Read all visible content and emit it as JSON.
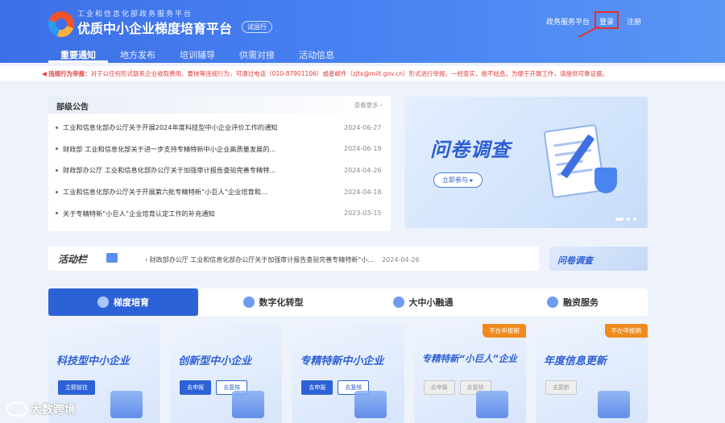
{
  "header": {
    "sub_title": "工业和信息化部政务服务平台",
    "title": "优质中小企业梯度培育平台",
    "badge": "试运行",
    "links": {
      "gov_portal": "政务服务平台",
      "login": "登录",
      "register": "注册"
    }
  },
  "nav": [
    "重要通知",
    "地方发布",
    "培训辅导",
    "供需对接",
    "活动信息"
  ],
  "warning": {
    "label": "违规行为举报：",
    "text": "对于以任何形式联系企业收取费用、要挟等违规行为，可通过电话（010-87901106）或者邮件（zjtx@miit.gov.cn）形式进行举报，一经查实，绝不姑息。为便于开展工作，请提供可靠证据。"
  },
  "announcements": {
    "title": "部级公告",
    "more": "查看更多 ›",
    "items": [
      {
        "title": "工业和信息化部办公厅关于开展2024年度科技型中小企业评价工作的通知",
        "date": "2024-06-27"
      },
      {
        "title": "财政部 工业和信息化部关于进一步支持专精特新中小企业高质量发展的...",
        "date": "2024-06-19"
      },
      {
        "title": "财政部办公厅 工业和信息化部办公厅关于加强审计报告查验完善专精特...",
        "date": "2024-04-26"
      },
      {
        "title": "工业和信息化部办公厅关于开展第六批专精特新“小巨人”企业培育和...",
        "date": "2024-04-18"
      },
      {
        "title": "关于专精特新“小巨人”企业培育认定工作的补充通知",
        "date": "2023-03-15"
      }
    ]
  },
  "banner": {
    "title": "问卷调查",
    "button": "立即参与 ▸"
  },
  "activity": {
    "title": "活动栏",
    "text": "财政部办公厅 工业和信息化部办公厅关于加强审计报告查验完善专精特新“小...",
    "date": "2024-04-26",
    "side_title": "问卷调查"
  },
  "tabs": [
    "梯度培育",
    "数字化转型",
    "大中小融通",
    "融资服务"
  ],
  "cards": [
    {
      "title": "科技型中小企业",
      "buttons": [
        "立即前往"
      ],
      "badge": ""
    },
    {
      "title": "创新型中小企业",
      "buttons": [
        "去申报",
        "去复核"
      ],
      "badge": ""
    },
    {
      "title": "专精特新中小企业",
      "buttons": [
        "去申报",
        "去复核"
      ],
      "badge": ""
    },
    {
      "title": "专精特新“小巨人”企业",
      "buttons": [
        "去申报",
        "去复核"
      ],
      "badge": "不在申报期"
    },
    {
      "title": "年度信息更新",
      "buttons": [
        "去更新"
      ],
      "badge": "不在申报期"
    }
  ],
  "watermark": "大数跨境"
}
